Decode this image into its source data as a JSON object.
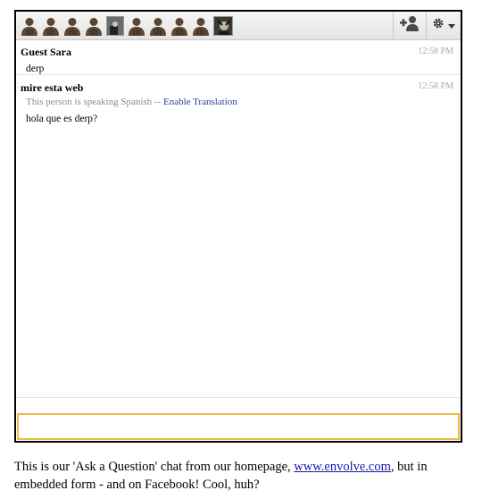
{
  "toolbar": {
    "participants": [
      {
        "kind": "person"
      },
      {
        "kind": "person"
      },
      {
        "kind": "person"
      },
      {
        "kind": "person"
      },
      {
        "kind": "photo"
      },
      {
        "kind": "person"
      },
      {
        "kind": "person"
      },
      {
        "kind": "person"
      },
      {
        "kind": "person"
      },
      {
        "kind": "photo"
      }
    ],
    "add_icon": "add-user-icon",
    "settings_icon": "gear-icon"
  },
  "messages": [
    {
      "sender": "Guest Sara",
      "time": "12:58 PM",
      "text": "derp"
    },
    {
      "sender": "mire esta web",
      "time": "12:58 PM",
      "note_prefix": "This person is speaking Spanish -- ",
      "note_link": "Enable Translation",
      "text": "hola que es derp?"
    }
  ],
  "input": {
    "value": "",
    "placeholder": ""
  },
  "caption": {
    "before": "This is our 'Ask a Question' chat from our homepage, ",
    "link": "www.envolve.com",
    "after": ", but in embedded form - and on Facebook! Cool, huh?"
  },
  "colors": {
    "input_border": "#f0b84a",
    "link": "#1a1aa6",
    "person_icon": "#5a4632"
  }
}
